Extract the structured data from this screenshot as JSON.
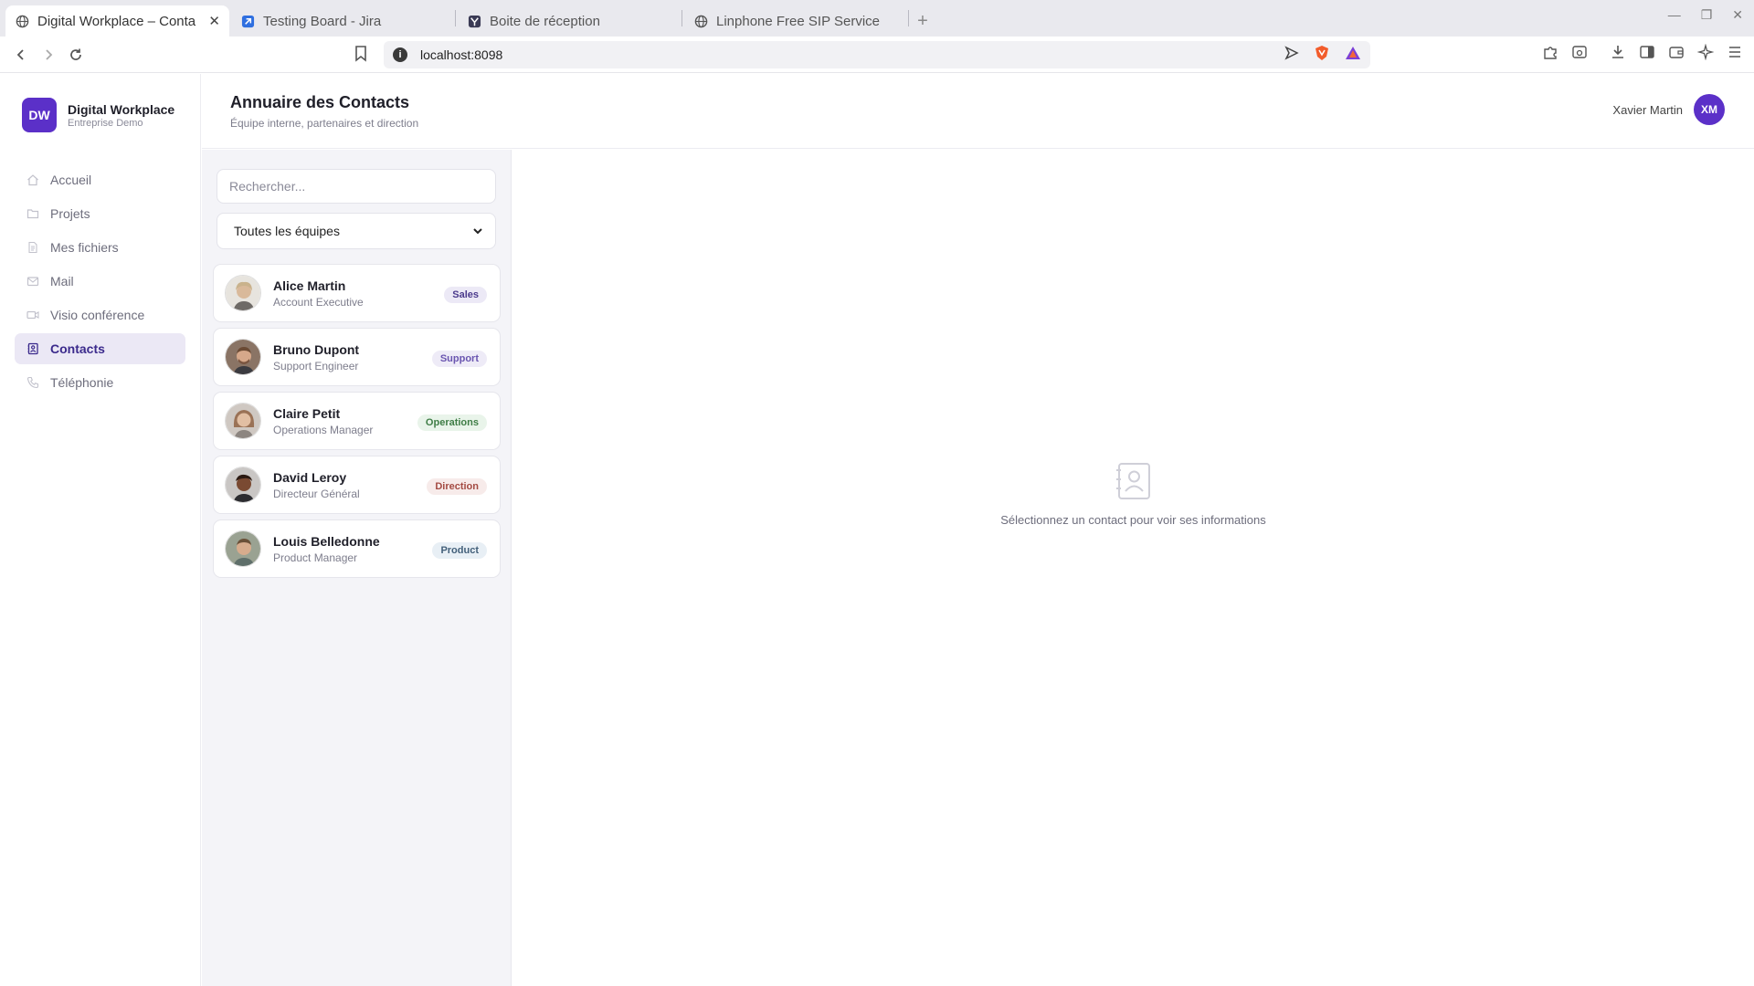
{
  "browser": {
    "tabs": [
      {
        "title": "Digital Workplace – Conta",
        "icon": "globe-icon",
        "active": true
      },
      {
        "title": "Testing Board - Jira",
        "icon": "jira-icon",
        "active": false
      },
      {
        "title": "Boite de réception",
        "icon": "mail-provider-icon",
        "active": false
      },
      {
        "title": "Linphone Free SIP Service",
        "icon": "globe-icon",
        "active": false
      }
    ],
    "url": "localhost:8098"
  },
  "brand": {
    "logo": "DW",
    "name": "Digital Workplace",
    "subtitle": "Entreprise Demo"
  },
  "nav": {
    "items": [
      {
        "label": "Accueil",
        "icon": "home-icon",
        "active": false
      },
      {
        "label": "Projets",
        "icon": "folder-icon",
        "active": false
      },
      {
        "label": "Mes fichiers",
        "icon": "file-icon",
        "active": false
      },
      {
        "label": "Mail",
        "icon": "mail-icon",
        "active": false
      },
      {
        "label": "Visio conférence",
        "icon": "video-icon",
        "active": false
      },
      {
        "label": "Contacts",
        "icon": "contacts-icon",
        "active": true
      },
      {
        "label": "Téléphonie",
        "icon": "phone-icon",
        "active": false
      }
    ]
  },
  "header": {
    "title": "Annuaire des Contacts",
    "subtitle": "Équipe interne, partenaires et direction"
  },
  "user": {
    "name": "Xavier Martin",
    "initials": "XM"
  },
  "search": {
    "placeholder": "Rechercher...",
    "value": ""
  },
  "filter": {
    "selected": "Toutes les équipes"
  },
  "contacts": [
    {
      "name": "Alice Martin",
      "role": "Account Executive",
      "team": "Sales",
      "badge_bg": "#ece9f6",
      "badge_fg": "#4b3a8c"
    },
    {
      "name": "Bruno Dupont",
      "role": "Support Engineer",
      "team": "Support",
      "badge_bg": "#eeebf7",
      "badge_fg": "#6a55b0"
    },
    {
      "name": "Claire Petit",
      "role": "Operations Manager",
      "team": "Operations",
      "badge_bg": "#e9f4ea",
      "badge_fg": "#3f7d46"
    },
    {
      "name": "David Leroy",
      "role": "Directeur Général",
      "team": "Direction",
      "badge_bg": "#f7ebea",
      "badge_fg": "#a44b43"
    },
    {
      "name": "Louis Belledonne",
      "role": "Product Manager",
      "team": "Product",
      "badge_bg": "#e8eff5",
      "badge_fg": "#43607a"
    }
  ],
  "detail": {
    "empty_text": "Sélectionnez un contact pour voir ses informations"
  },
  "colors": {
    "accent": "#5b30c8",
    "active_nav_bg": "#ebe8f5"
  }
}
